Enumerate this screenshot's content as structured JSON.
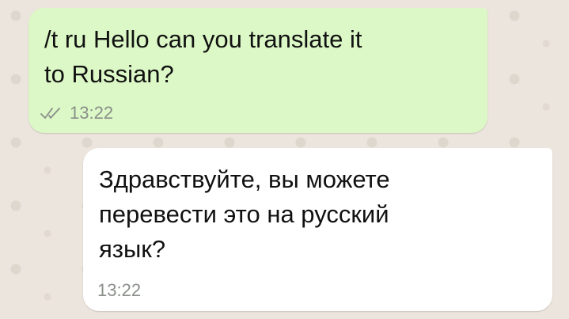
{
  "messages": [
    {
      "direction": "outgoing",
      "text": "/t ru Hello can you translate it\nto Russian?",
      "time": "13:22",
      "status_icon": "double-check-icon"
    },
    {
      "direction": "incoming",
      "text": "Здравствуйте, вы можете\nперевести это на русский\nязык?",
      "time": "13:22"
    }
  ],
  "colors": {
    "outgoing_bubble": "#dcf8c6",
    "incoming_bubble": "#ffffff",
    "background": "#ece5dd",
    "meta_text": "#8a8f8a"
  }
}
